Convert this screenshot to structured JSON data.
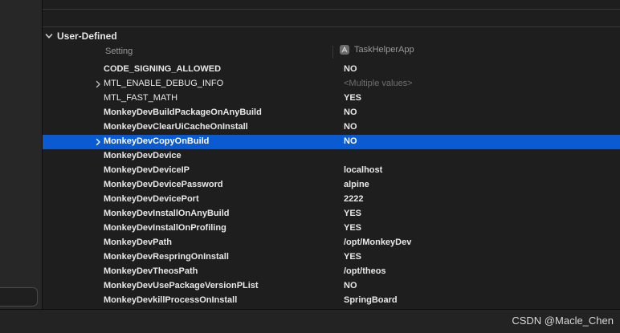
{
  "section": {
    "title": "User-Defined"
  },
  "columns": {
    "setting": "Setting",
    "target": "TaskHelperApp"
  },
  "rows": [
    {
      "name": "CODE_SIGNING_ALLOWED",
      "value": "NO",
      "bold": true,
      "expandable": false,
      "muted": false,
      "selected": false
    },
    {
      "name": "MTL_ENABLE_DEBUG_INFO",
      "value": "<Multiple values>",
      "bold": false,
      "expandable": true,
      "muted": true,
      "selected": false
    },
    {
      "name": "MTL_FAST_MATH",
      "value": "YES",
      "bold": false,
      "expandable": false,
      "muted": false,
      "selected": false
    },
    {
      "name": "MonkeyDevBuildPackageOnAnyBuild",
      "value": "NO",
      "bold": true,
      "expandable": false,
      "muted": false,
      "selected": false
    },
    {
      "name": "MonkeyDevClearUiCacheOnInstall",
      "value": "NO",
      "bold": true,
      "expandable": false,
      "muted": false,
      "selected": false
    },
    {
      "name": "MonkeyDevCopyOnBuild",
      "value": "NO",
      "bold": true,
      "expandable": true,
      "muted": false,
      "selected": true
    },
    {
      "name": "MonkeyDevDevice",
      "value": "",
      "bold": true,
      "expandable": false,
      "muted": false,
      "selected": false
    },
    {
      "name": "MonkeyDevDeviceIP",
      "value": "localhost",
      "bold": true,
      "expandable": false,
      "muted": false,
      "selected": false
    },
    {
      "name": "MonkeyDevDevicePassword",
      "value": "alpine",
      "bold": true,
      "expandable": false,
      "muted": false,
      "selected": false
    },
    {
      "name": "MonkeyDevDevicePort",
      "value": "2222",
      "bold": true,
      "expandable": false,
      "muted": false,
      "selected": false
    },
    {
      "name": "MonkeyDevInstallOnAnyBuild",
      "value": "YES",
      "bold": true,
      "expandable": false,
      "muted": false,
      "selected": false
    },
    {
      "name": "MonkeyDevInstallOnProfiling",
      "value": "YES",
      "bold": true,
      "expandable": false,
      "muted": false,
      "selected": false
    },
    {
      "name": "MonkeyDevPath",
      "value": "/opt/MonkeyDev",
      "bold": true,
      "expandable": false,
      "muted": false,
      "selected": false
    },
    {
      "name": "MonkeyDevRespringOnInstall",
      "value": "YES",
      "bold": true,
      "expandable": false,
      "muted": false,
      "selected": false
    },
    {
      "name": "MonkeyDevTheosPath",
      "value": "/opt/theos",
      "bold": true,
      "expandable": false,
      "muted": false,
      "selected": false
    },
    {
      "name": "MonkeyDevUsePackageVersionPList",
      "value": "NO",
      "bold": true,
      "expandable": false,
      "muted": false,
      "selected": false
    },
    {
      "name": "MonkeyDevkillProcessOnInstall",
      "value": "SpringBoard",
      "bold": true,
      "expandable": false,
      "muted": false,
      "selected": false
    }
  ],
  "watermark": "CSDN @Macle_Chen",
  "colors": {
    "selection": "#0a5ad2",
    "background": "#1e1e1e"
  }
}
